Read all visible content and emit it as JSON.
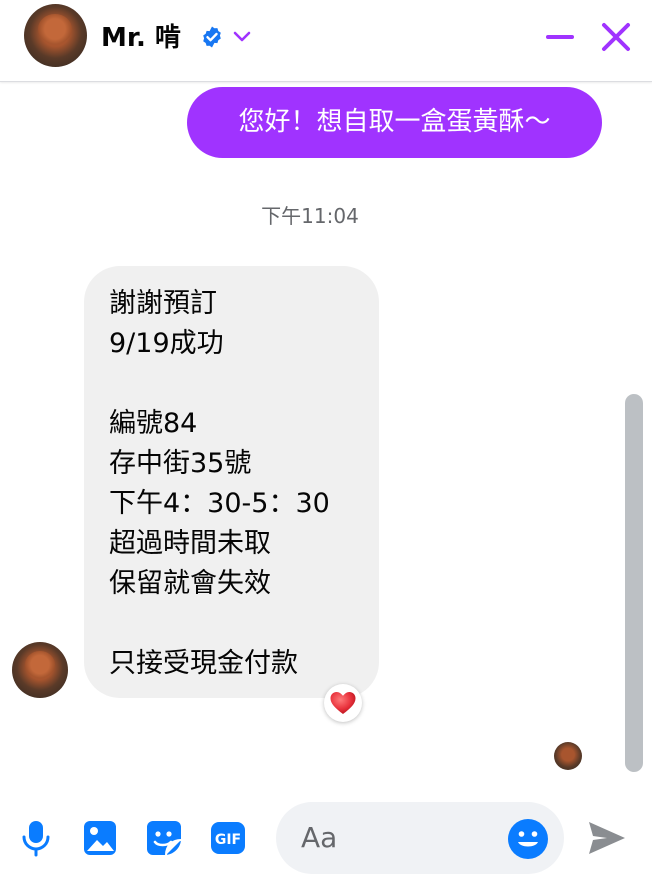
{
  "header": {
    "contact_name": "Mr. 啃",
    "verified": true
  },
  "messages": {
    "sent_text": "您好！想自取一盒蛋黃酥～",
    "timestamp": "下午11:04",
    "received_text": "謝謝預訂\n9/19成功\n\n編號84\n存中街35號\n下午4：30-5：30\n超過時間未取\n保留就會失效\n\n只接受現金付款",
    "reaction": "heart"
  },
  "composer": {
    "placeholder": "Aa",
    "gif_label": "GIF"
  },
  "colors": {
    "accent": "#a033ff",
    "icon_blue": "#0a7cff",
    "sent_bubble": "#a033ff",
    "received_bubble": "#f0f0f0"
  },
  "icons": [
    "verified-badge-icon",
    "chevron-down-icon",
    "minimize-icon",
    "close-icon",
    "microphone-icon",
    "image-icon",
    "sticker-icon",
    "gif-icon",
    "emoji-icon",
    "send-icon",
    "heart-reaction-icon"
  ]
}
